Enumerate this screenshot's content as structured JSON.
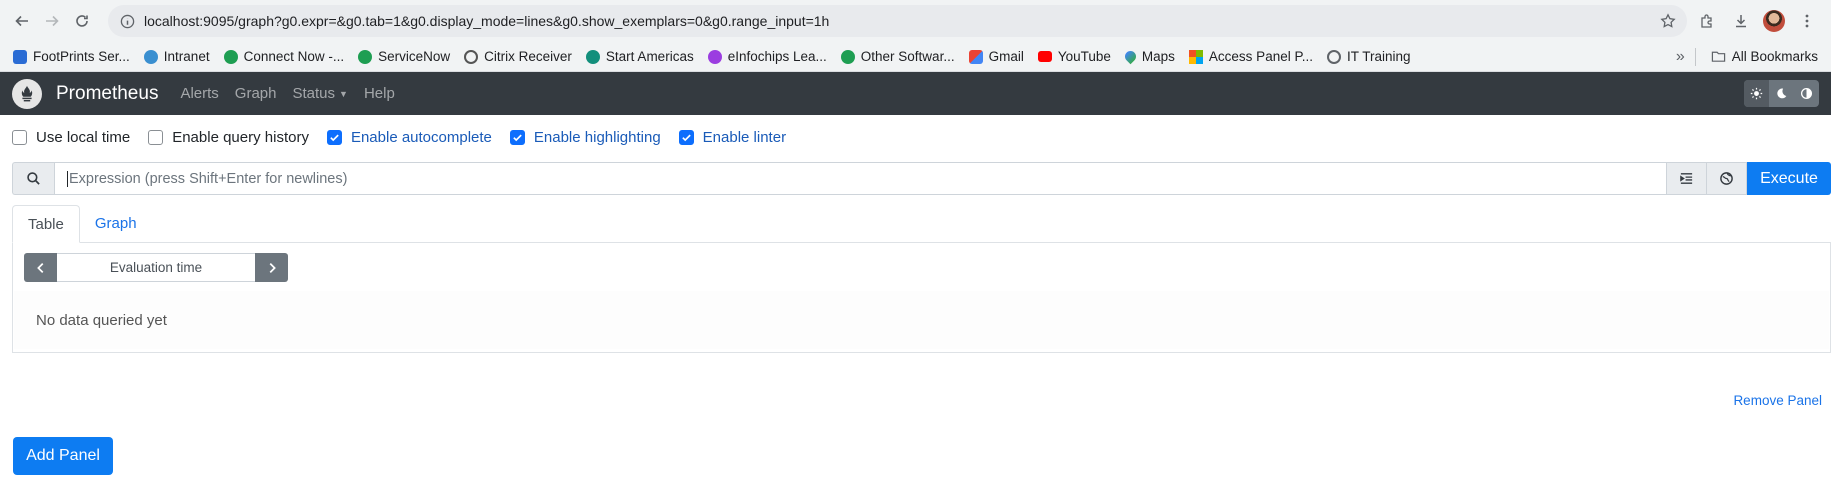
{
  "browser": {
    "url": "localhost:9095/graph?g0.expr=&g0.tab=1&g0.display_mode=lines&g0.show_exemplars=0&g0.range_input=1h",
    "bookmarks": [
      {
        "label": "FootPrints Ser...",
        "color": "#2b6cd4"
      },
      {
        "label": "Intranet",
        "color": "#3a8fd0"
      },
      {
        "label": "Connect Now -...",
        "color": "#1e9e52"
      },
      {
        "label": "ServiceNow",
        "color": "#1e9e52"
      },
      {
        "label": "Citrix Receiver",
        "color": "#555555"
      },
      {
        "label": "Start Americas",
        "color": "#138f7c"
      },
      {
        "label": "eInfochips Lea...",
        "color": "#9b3de0"
      },
      {
        "label": "Other Softwar...",
        "color": "#1e9e52"
      },
      {
        "label": "Gmail",
        "color": "#d93025"
      },
      {
        "label": "YouTube",
        "color": "#ff0000"
      },
      {
        "label": "Maps",
        "color": "#34a853"
      },
      {
        "label": "Access Panel P...",
        "color": "#f25022"
      },
      {
        "label": "IT Training",
        "color": "#5f6368"
      }
    ],
    "all_bookmarks_label": "All Bookmarks"
  },
  "navbar": {
    "brand": "Prometheus",
    "links": {
      "alerts": "Alerts",
      "graph": "Graph",
      "status": "Status",
      "help": "Help"
    }
  },
  "options": {
    "use_local_time": {
      "label": "Use local time",
      "checked": false
    },
    "query_history": {
      "label": "Enable query history",
      "checked": false
    },
    "autocomplete": {
      "label": "Enable autocomplete",
      "checked": true
    },
    "highlighting": {
      "label": "Enable highlighting",
      "checked": true
    },
    "linter": {
      "label": "Enable linter",
      "checked": true
    }
  },
  "expression": {
    "placeholder": "Expression (press Shift+Enter for newlines)",
    "execute_label": "Execute"
  },
  "panel": {
    "tabs": {
      "table": "Table",
      "graph": "Graph"
    },
    "active_tab": "Table",
    "eval_time_placeholder": "Evaluation time",
    "no_data": "No data queried yet",
    "remove_label": "Remove Panel"
  },
  "add_panel_label": "Add Panel",
  "colors": {
    "primary": "#0d7cf2",
    "navbar": "#343a40"
  }
}
